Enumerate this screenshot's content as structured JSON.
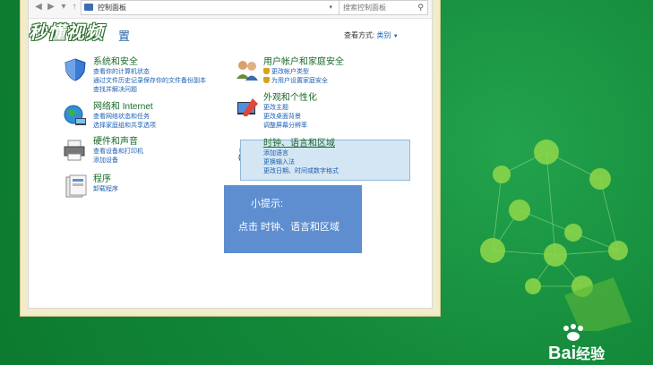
{
  "window": {
    "address": "控制面板",
    "search_placeholder": "搜索控制面板"
  },
  "logo": {
    "text": "秒懂视频",
    "title_tail": "置"
  },
  "view_by": {
    "label": "查看方式:",
    "value": "类别"
  },
  "categories": [
    {
      "title": "系统和安全",
      "links": [
        "查看你的计算机状态",
        "通过文件历史记录保存你的文件备份副本",
        "查找并解决问题"
      ]
    },
    {
      "title": "网络和 Internet",
      "links": [
        "查看网络状态和任务",
        "选择家庭组和共享选项"
      ]
    },
    {
      "title": "硬件和声音",
      "links": [
        "查看设备和打印机",
        "添加设备"
      ]
    },
    {
      "title": "程序",
      "links": [
        "卸载程序"
      ]
    },
    {
      "title": "用户帐户和家庭安全",
      "links": [
        "更改帐户类型",
        "为用户设置家庭安全"
      ]
    },
    {
      "title": "外观和个性化",
      "links": [
        "更改主题",
        "更改桌面背景",
        "调整屏幕分辨率"
      ]
    },
    {
      "title": "时钟、语言和区域",
      "links": [
        "添加语言",
        "更换输入法",
        "更改日期、时间或数字格式"
      ]
    }
  ],
  "tip": {
    "title": "小提示:",
    "text": "点击 时钟、语言和区域"
  },
  "watermark": {
    "brand": "Bai",
    "suffix": "经验"
  },
  "colors": {
    "background": "#13893a",
    "tip": "#5e8ed0",
    "highlight": "#d4e6f3",
    "link": "#1a5fb4",
    "category_title": "#1a6a2a"
  }
}
